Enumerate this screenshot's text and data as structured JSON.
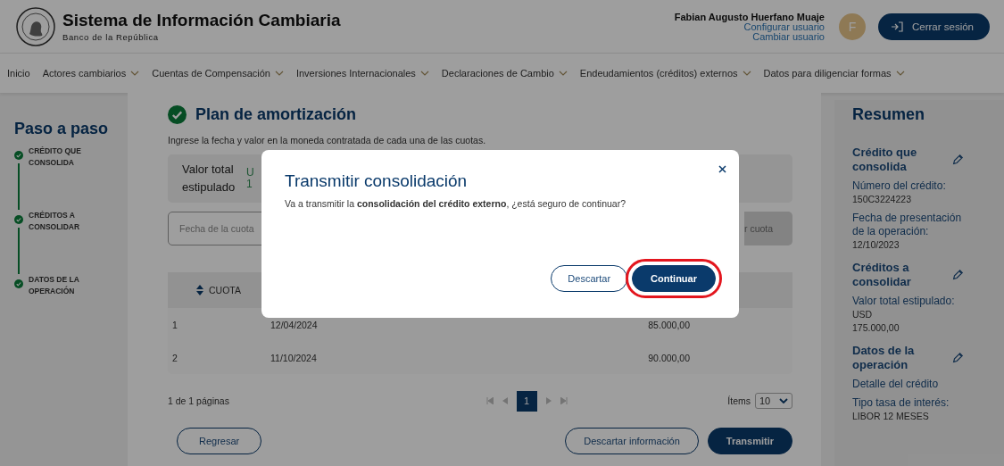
{
  "header": {
    "title": "Sistema de Información Cambiaria",
    "subtitle": "Banco de la República",
    "user": {
      "name": "Fabian Augusto Huerfano Muaje",
      "links": [
        "Configurar usuario",
        "Cambiar usuario"
      ],
      "avatar_initial": "F"
    },
    "logout_button": "Cerrar sesión"
  },
  "nav": [
    {
      "label": "Inicio",
      "has_menu": false
    },
    {
      "label": "Actores cambiarios",
      "has_menu": true
    },
    {
      "label": "Cuentas de Compensación",
      "has_menu": true
    },
    {
      "label": "Inversiones Internacionales",
      "has_menu": true
    },
    {
      "label": "Declaraciones de Cambio",
      "has_menu": true
    },
    {
      "label": "Endeudamientos (créditos) externos",
      "has_menu": true
    },
    {
      "label": "Datos para diligenciar formas",
      "has_menu": true
    }
  ],
  "steps": {
    "title": "Paso a paso",
    "items": [
      {
        "label": "CRÉDITO QUE CONSOLIDA",
        "done": true
      },
      {
        "label": "CRÉDITOS A CONSOLIDAR",
        "done": true
      },
      {
        "label": "DATOS DE LA OPERACIÓN",
        "done": true
      }
    ]
  },
  "main": {
    "title": "Plan de amortización",
    "done": true,
    "instruction": "Ingrese la fecha y valor en la moneda contratada de cada una de las cuotas.",
    "total_card": {
      "label": "Valor total estipulado",
      "currency": "U",
      "amount": "1"
    },
    "date_field": {
      "placeholder": "Fecha de la cuota"
    },
    "add_button": "r cuota",
    "table": {
      "columns": [
        "CUOTA"
      ],
      "rows": [
        [
          "1",
          "12/04/2024",
          "85.000,00"
        ],
        [
          "2",
          "11/10/2024",
          "90.000,00"
        ]
      ]
    },
    "pagination": {
      "summary": "1 de 1 páginas",
      "pages": [
        {
          "label": "1",
          "selected": true
        }
      ],
      "items_label": "Ítems",
      "page_size": "10"
    },
    "buttons": [
      {
        "label": "Regresar",
        "kind": "outline"
      },
      {
        "label": "Descartar información",
        "kind": "outline"
      },
      {
        "label": "Transmitir",
        "kind": "primary"
      }
    ]
  },
  "summary": {
    "title": "Resumen",
    "sections": [
      {
        "title": "Crédito que consolida",
        "items": [
          {
            "label": "Número del crédito:",
            "values": [
              "150C3224223"
            ]
          },
          {
            "label": "Fecha de presentación de la operación:",
            "values": [
              "12/10/2023"
            ]
          }
        ]
      },
      {
        "title": "Créditos a consolidar",
        "items": [
          {
            "label": "Valor total estipulado:",
            "values": [
              "USD",
              "175.000,00"
            ]
          }
        ]
      },
      {
        "title": "Datos de la operación",
        "items": [
          {
            "label": "Detalle del crédito"
          },
          {
            "label": "Tipo tasa de interés:",
            "values": [
              "LIBOR 12 MESES"
            ]
          }
        ]
      }
    ]
  },
  "modal": {
    "title": "Transmitir consolidación",
    "message": "Va a transmitir la **consolidación del crédito externo**, ¿está seguro de continuar?",
    "buttons": [
      {
        "label": "Descartar",
        "kind": "outline",
        "highlighted": false
      },
      {
        "label": "Continuar",
        "kind": "primary",
        "highlighted": true
      }
    ]
  }
}
